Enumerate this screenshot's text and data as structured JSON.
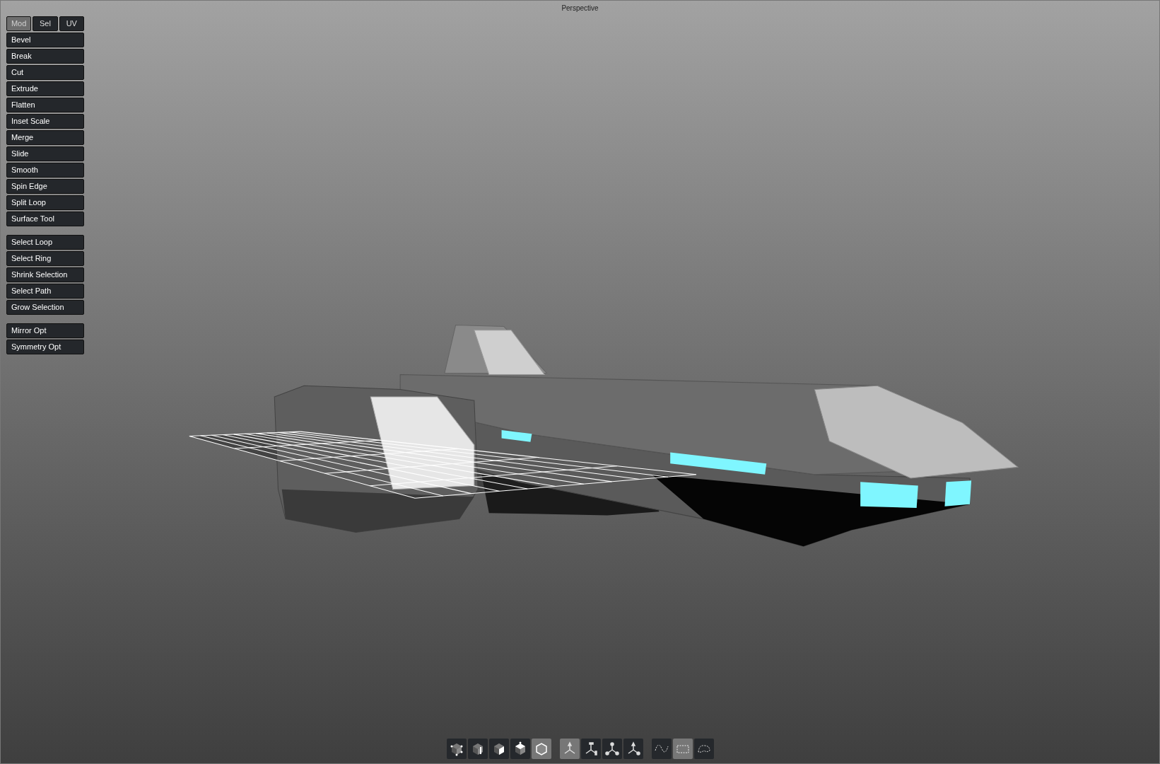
{
  "viewport": {
    "title": "Perspective"
  },
  "tabs": [
    {
      "label": "Mod",
      "selected": true
    },
    {
      "label": "Sel",
      "selected": false
    },
    {
      "label": "UV",
      "selected": false
    }
  ],
  "tool_groups": [
    [
      "Bevel",
      "Break",
      "Cut",
      "Extrude",
      "Flatten",
      "Inset Scale",
      "Merge",
      "Slide",
      "Smooth",
      "Spin Edge",
      "Split Loop",
      "Surface Tool"
    ],
    [
      "Select Loop",
      "Select Ring",
      "Shrink Selection",
      "Select Path",
      "Grow Selection"
    ],
    [
      "Mirror Opt",
      "Symmetry Opt"
    ]
  ],
  "toolbar": [
    [
      {
        "kind": "vertex",
        "selected": false
      },
      {
        "kind": "edge",
        "selected": false
      },
      {
        "kind": "face",
        "selected": false
      },
      {
        "kind": "element",
        "selected": false
      },
      {
        "kind": "object",
        "selected": true
      }
    ],
    [
      {
        "kind": "universal",
        "selected": true
      },
      {
        "kind": "move",
        "selected": false
      },
      {
        "kind": "rotate",
        "selected": false
      },
      {
        "kind": "scale",
        "selected": false
      }
    ],
    [
      {
        "kind": "lasso",
        "selected": false
      },
      {
        "kind": "rect",
        "selected": true
      },
      {
        "kind": "paint",
        "selected": false
      }
    ]
  ]
}
